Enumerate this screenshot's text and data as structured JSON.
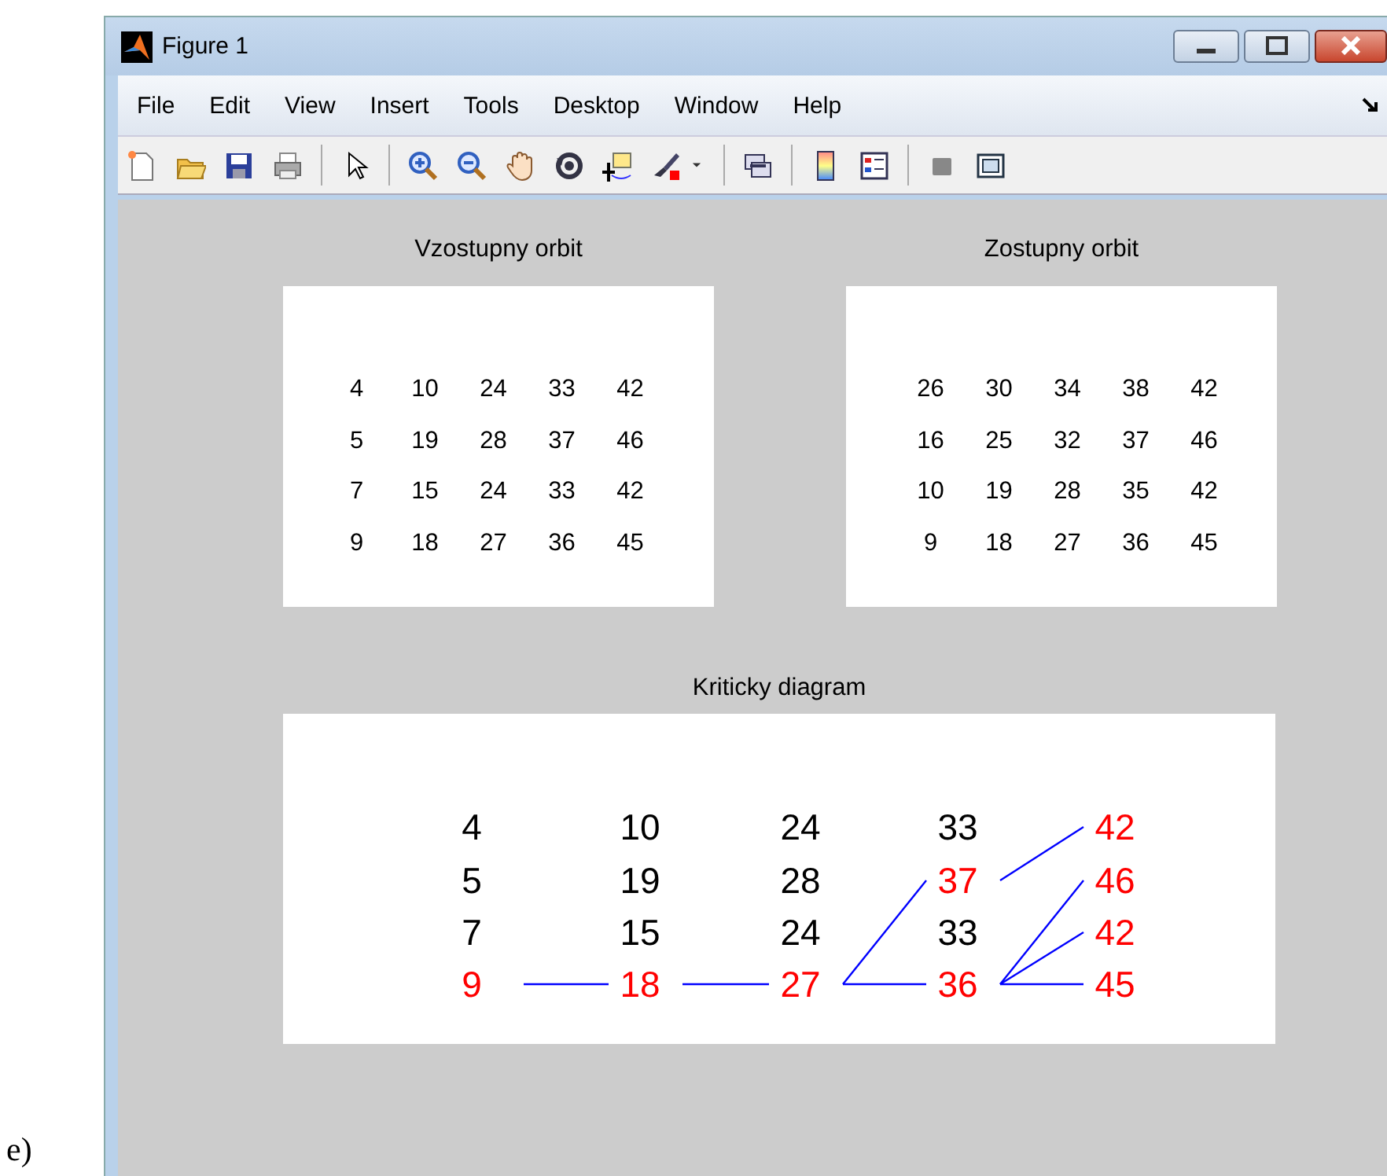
{
  "caption_label": "e)",
  "window": {
    "title": "Figure 1"
  },
  "menu": [
    "File",
    "Edit",
    "View",
    "Insert",
    "Tools",
    "Desktop",
    "Window",
    "Help"
  ],
  "tables": [
    {
      "title": "Vzostupny orbit",
      "rows": [
        [
          "4",
          "10",
          "24",
          "33",
          "42"
        ],
        [
          "5",
          "19",
          "28",
          "37",
          "46"
        ],
        [
          "7",
          "15",
          "24",
          "33",
          "42"
        ],
        [
          "9",
          "18",
          "27",
          "36",
          "45"
        ]
      ]
    },
    {
      "title": "Zostupny orbit",
      "rows": [
        [
          "26",
          "30",
          "34",
          "38",
          "42"
        ],
        [
          "16",
          "25",
          "32",
          "37",
          "46"
        ],
        [
          "10",
          "19",
          "28",
          "35",
          "42"
        ],
        [
          "9",
          "18",
          "27",
          "36",
          "45"
        ]
      ]
    }
  ],
  "diagram": {
    "title": "Kriticky diagram",
    "rows": [
      [
        {
          "value": "4",
          "color": "#000000"
        },
        {
          "value": "10",
          "color": "#000000"
        },
        {
          "value": "24",
          "color": "#000000"
        },
        {
          "value": "33",
          "color": "#000000"
        },
        {
          "value": "42",
          "color": "#ff0000"
        }
      ],
      [
        {
          "value": "5",
          "color": "#000000"
        },
        {
          "value": "19",
          "color": "#000000"
        },
        {
          "value": "28",
          "color": "#000000"
        },
        {
          "value": "37",
          "color": "#ff0000"
        },
        {
          "value": "46",
          "color": "#ff0000"
        }
      ],
      [
        {
          "value": "7",
          "color": "#000000"
        },
        {
          "value": "15",
          "color": "#000000"
        },
        {
          "value": "24",
          "color": "#000000"
        },
        {
          "value": "33",
          "color": "#000000"
        },
        {
          "value": "42",
          "color": "#ff0000"
        }
      ],
      [
        {
          "value": "9",
          "color": "#ff0000"
        },
        {
          "value": "18",
          "color": "#ff0000"
        },
        {
          "value": "27",
          "color": "#ff0000"
        },
        {
          "value": "36",
          "color": "#ff0000"
        },
        {
          "value": "45",
          "color": "#ff0000"
        }
      ]
    ]
  }
}
